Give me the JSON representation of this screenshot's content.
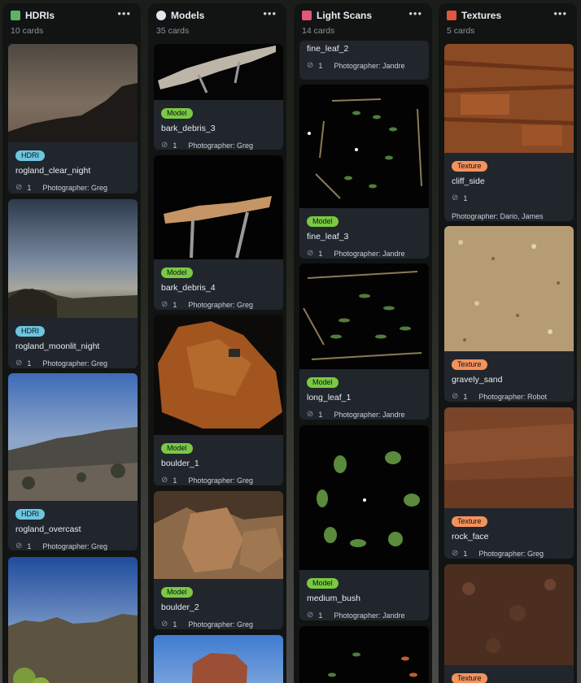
{
  "columns": [
    {
      "title": "HDRIs",
      "count": "10 cards",
      "emoji_color": "#5bb36a",
      "cards": [
        {
          "thumb": "hdri_clear_night",
          "label": "HDRI",
          "title": "rogland_clear_night",
          "attach": "1",
          "photographer": "Photographer: Greg"
        },
        {
          "thumb": "hdri_moonlit",
          "label": "HDRI",
          "title": "rogland_moonlit_night",
          "attach": "1",
          "photographer": "Photographer: Greg"
        },
        {
          "thumb": "hdri_overcast",
          "label": "HDRI",
          "title": "rogland_overcast",
          "attach": "1",
          "photographer": "Photographer: Greg"
        },
        {
          "thumb": "hdri_sunset",
          "label": "",
          "title": "",
          "attach": "",
          "photographer": ""
        }
      ]
    },
    {
      "title": "Models",
      "count": "35 cards",
      "emoji_color": "#dfe6ee",
      "cards": [
        {
          "thumb": "model_bark3",
          "label": "Model",
          "title": "bark_debris_3",
          "attach": "1",
          "photographer": "Photographer: Greg"
        },
        {
          "thumb": "model_bark4",
          "label": "Model",
          "title": "bark_debris_4",
          "attach": "1",
          "photographer": "Photographer: Greg"
        },
        {
          "thumb": "model_boulder1",
          "label": "Model",
          "title": "boulder_1",
          "attach": "1",
          "photographer": "Photographer: Greg"
        },
        {
          "thumb": "model_boulder2",
          "label": "Model",
          "title": "boulder_2",
          "attach": "1",
          "photographer": "Photographer: Greg"
        },
        {
          "thumb": "model_rock",
          "label": "",
          "title": "",
          "attach": "",
          "photographer": ""
        }
      ]
    },
    {
      "title": "Light Scans",
      "count": "14 cards",
      "emoji_color": "#e4567a",
      "cards": [
        {
          "thumb": "",
          "label": "",
          "title": "fine_leaf_2",
          "attach": "1",
          "photographer": "Photographer: Jandre"
        },
        {
          "thumb": "scan_fine_leaf3",
          "label": "Model",
          "title": "fine_leaf_3",
          "attach": "1",
          "photographer": "Photographer: Jandre"
        },
        {
          "thumb": "scan_long_leaf",
          "label": "Model",
          "title": "long_leaf_1",
          "attach": "1",
          "photographer": "Photographer: Jandre"
        },
        {
          "thumb": "scan_bush",
          "label": "Model",
          "title": "medium_bush",
          "attach": "1",
          "photographer": "Photographer: Jandre"
        },
        {
          "thumb": "scan_mixed",
          "label": "",
          "title": "",
          "attach": "",
          "photographer": ""
        }
      ]
    },
    {
      "title": "Textures",
      "count": "5 cards",
      "emoji_color": "#e0573b",
      "cards": [
        {
          "thumb": "tex_cliff",
          "label": "Texture",
          "title": "cliff_side",
          "attach": "1",
          "photographer": "Photographer: Dario, James"
        },
        {
          "thumb": "tex_sand",
          "label": "Texture",
          "title": "gravely_sand",
          "attach": "1",
          "photographer": "Photographer: Robot"
        },
        {
          "thumb": "tex_rockface",
          "label": "Texture",
          "title": "rock_face",
          "attach": "1",
          "photographer": "Photographer: Greg"
        },
        {
          "thumb": "tex_dark",
          "label": "Texture",
          "title": "",
          "attach": "",
          "photographer": ""
        }
      ]
    }
  ],
  "menu_glyph": "•••",
  "attach_glyph": "⊘"
}
